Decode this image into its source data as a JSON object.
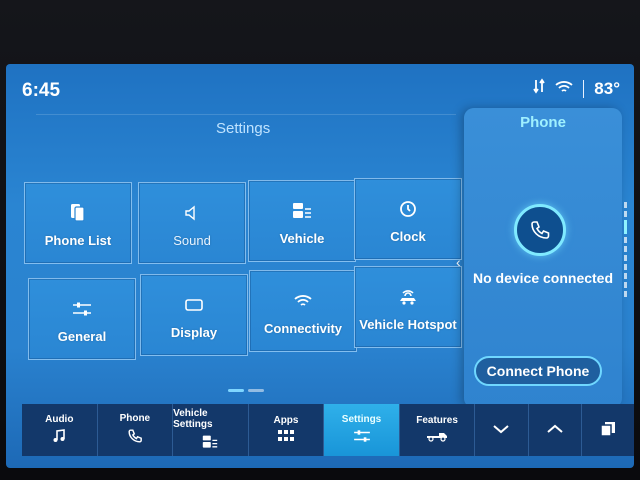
{
  "status": {
    "time": "6:45",
    "temperature": "83°"
  },
  "settings": {
    "title": "Settings",
    "tiles": [
      {
        "label": "Phone List",
        "icon": "phone-list-icon"
      },
      {
        "label": "Sound",
        "icon": "speaker-icon"
      },
      {
        "label": "Vehicle",
        "icon": "vehicle-settings-icon"
      },
      {
        "label": "Clock",
        "icon": "clock-icon"
      },
      {
        "label": "General",
        "icon": "sliders-icon"
      },
      {
        "label": "Display",
        "icon": "display-icon"
      },
      {
        "label": "Connectivity",
        "icon": "wifi-icon"
      },
      {
        "label": "Vehicle Hotspot",
        "icon": "hotspot-icon"
      }
    ],
    "pager": {
      "pages": 2,
      "current": 1
    }
  },
  "phone_panel": {
    "title": "Phone",
    "status": "No device connected",
    "connect_label": "Connect Phone"
  },
  "nav": {
    "items": [
      {
        "label": "Audio",
        "icon": "music-note-icon"
      },
      {
        "label": "Phone",
        "icon": "phone-icon"
      },
      {
        "label": "Vehicle Settings",
        "icon": "vehicle-settings-icon"
      },
      {
        "label": "Apps",
        "icon": "apps-grid-icon"
      },
      {
        "label": "Settings",
        "icon": "sliders-icon",
        "active": true
      },
      {
        "label": "Features",
        "icon": "truck-icon"
      }
    ]
  },
  "colors": {
    "screen": "#2a85d2",
    "active_nav": "#1995d8",
    "accent": "#7fe9ff",
    "nav_bg": "#13386a"
  }
}
